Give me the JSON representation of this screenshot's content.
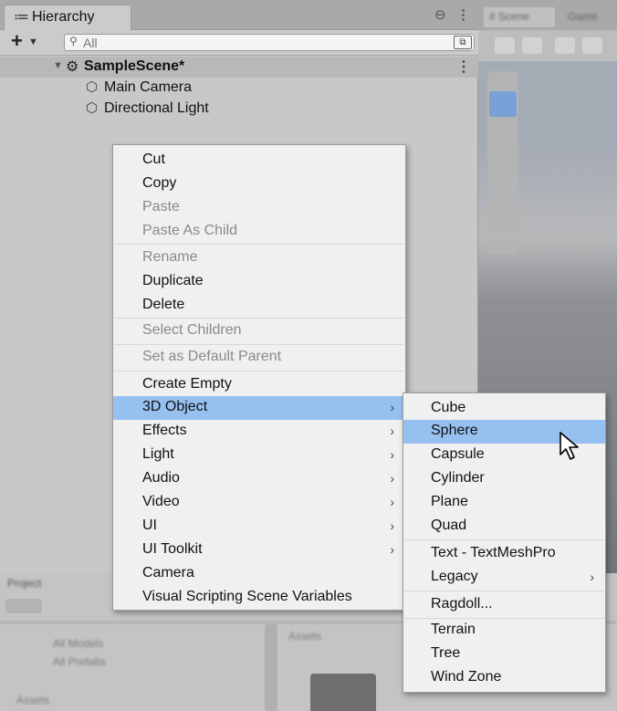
{
  "hierarchy": {
    "tab_title": "Hierarchy",
    "tab_icon": "≔",
    "lock_icon": "⊖",
    "more_icon": "⋮",
    "add_icon": "+",
    "add_arrow": "▼",
    "search_icon": "⚲",
    "search_placeholder": "All",
    "search_options_icon": "⧉",
    "scene_foldout": "▼",
    "scene_icon": "⚙",
    "scene_name": "SampleScene*",
    "scene_more": "⋮",
    "objects": [
      {
        "icon": "⬡",
        "label": "Main Camera"
      },
      {
        "icon": "⬡",
        "label": "Directional Light"
      }
    ]
  },
  "scene_panel": {
    "tab_label": "# Scene",
    "tab2_label": "Game"
  },
  "project_panel": {
    "tab_label": "Project",
    "items": [
      "All Models",
      "All Prefabs"
    ],
    "folder_label": "Assets",
    "footer": "Assets"
  },
  "context_menu": {
    "items": [
      {
        "label": "Cut",
        "state": "enabled"
      },
      {
        "label": "Copy",
        "state": "enabled"
      },
      {
        "label": "Paste",
        "state": "disabled"
      },
      {
        "label": "Paste As Child",
        "state": "disabled"
      },
      {
        "label": "Rename",
        "state": "disabled"
      },
      {
        "label": "Duplicate",
        "state": "enabled"
      },
      {
        "label": "Delete",
        "state": "enabled"
      },
      {
        "label": "Select Children",
        "state": "disabled"
      },
      {
        "label": "Set as Default Parent",
        "state": "disabled"
      },
      {
        "label": "Create Empty",
        "state": "enabled"
      },
      {
        "label": "3D Object",
        "state": "highlighted",
        "submenu": true
      },
      {
        "label": "Effects",
        "state": "enabled",
        "submenu": true
      },
      {
        "label": "Light",
        "state": "enabled",
        "submenu": true
      },
      {
        "label": "Audio",
        "state": "enabled",
        "submenu": true
      },
      {
        "label": "Video",
        "state": "enabled",
        "submenu": true
      },
      {
        "label": "UI",
        "state": "enabled",
        "submenu": true
      },
      {
        "label": "UI Toolkit",
        "state": "enabled",
        "submenu": true
      },
      {
        "label": "Camera",
        "state": "enabled"
      },
      {
        "label": "Visual Scripting Scene Variables",
        "state": "enabled"
      }
    ],
    "submenu_arrow": "›"
  },
  "submenu_3d_object": {
    "items": [
      {
        "label": "Cube",
        "state": "enabled"
      },
      {
        "label": "Sphere",
        "state": "highlighted"
      },
      {
        "label": "Capsule",
        "state": "enabled"
      },
      {
        "label": "Cylinder",
        "state": "enabled"
      },
      {
        "label": "Plane",
        "state": "enabled"
      },
      {
        "label": "Quad",
        "state": "enabled"
      },
      {
        "label": "Text - TextMeshPro",
        "state": "enabled"
      },
      {
        "label": "Legacy",
        "state": "enabled",
        "submenu": true
      },
      {
        "label": "Ragdoll...",
        "state": "enabled"
      },
      {
        "label": "Terrain",
        "state": "enabled"
      },
      {
        "label": "Tree",
        "state": "enabled"
      },
      {
        "label": "Wind Zone",
        "state": "enabled"
      }
    ]
  },
  "colors": {
    "highlight": "#96c0f0",
    "menu_bg": "#f0f0f0",
    "disabled_text": "#8a8a8a"
  }
}
